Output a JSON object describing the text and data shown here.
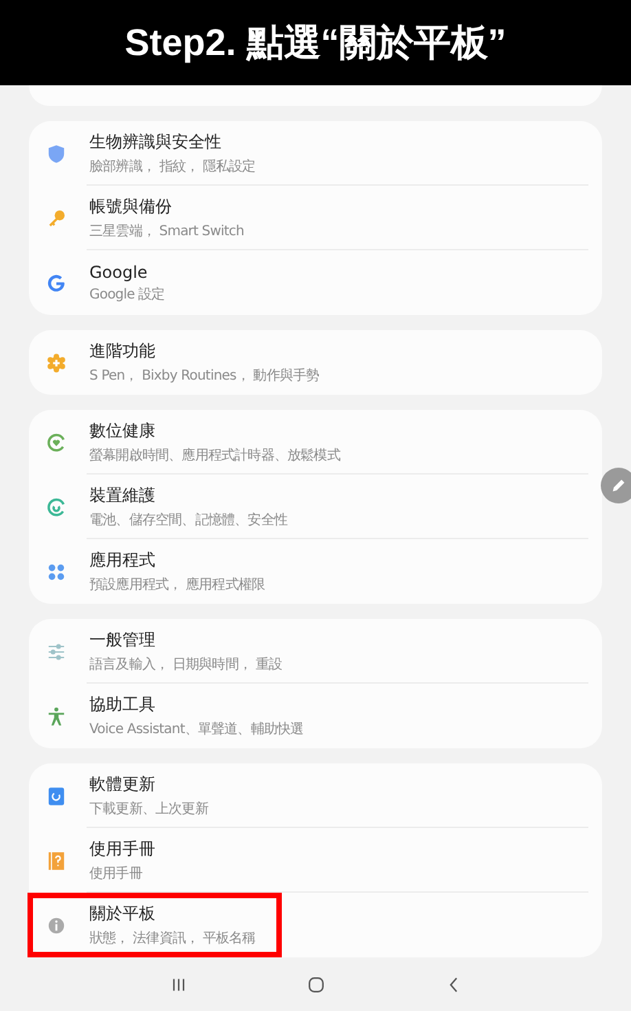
{
  "banner": {
    "title": "Step2. 點選“關於平板”"
  },
  "groups": [
    {
      "items": [
        {
          "kind": "shield",
          "title": "生物辨識與安全性",
          "subtitle": "臉部辨識， 指紋， 隱私設定",
          "highlighted": false
        },
        {
          "kind": "key",
          "title": "帳號與備份",
          "subtitle": "三星雲端， Smart Switch",
          "highlighted": false
        },
        {
          "kind": "google",
          "title": "Google",
          "subtitle": "Google 設定",
          "highlighted": false
        }
      ]
    },
    {
      "items": [
        {
          "kind": "gear",
          "title": "進階功能",
          "subtitle": "S Pen， Bixby Routines， 動作與手勢",
          "highlighted": false
        }
      ]
    },
    {
      "items": [
        {
          "kind": "wellbeing",
          "title": "數位健康",
          "subtitle": "螢幕開啟時間、應用程式計時器、放鬆模式",
          "highlighted": false
        },
        {
          "kind": "care",
          "title": "裝置維護",
          "subtitle": "電池、儲存空間、記憶體、安全性",
          "highlighted": false
        },
        {
          "kind": "apps",
          "title": "應用程式",
          "subtitle": "預設應用程式， 應用程式權限",
          "highlighted": false
        }
      ]
    },
    {
      "items": [
        {
          "kind": "sliders",
          "title": "一般管理",
          "subtitle": "語言及輸入， 日期與時間， 重設",
          "highlighted": false
        },
        {
          "kind": "accessibility",
          "title": "協助工具",
          "subtitle": "Voice Assistant、單聲道、輔助快選",
          "highlighted": false
        }
      ]
    },
    {
      "items": [
        {
          "kind": "update",
          "title": "軟體更新",
          "subtitle": "下載更新、上次更新",
          "highlighted": false
        },
        {
          "kind": "manual",
          "title": "使用手冊",
          "subtitle": "使用手冊",
          "highlighted": false
        },
        {
          "kind": "info",
          "title": "關於平板",
          "subtitle": "狀態， 法律資訊， 平板名稱",
          "highlighted": true
        }
      ]
    }
  ],
  "nav": [
    {
      "kind": "recents"
    },
    {
      "kind": "home"
    },
    {
      "kind": "back"
    }
  ]
}
